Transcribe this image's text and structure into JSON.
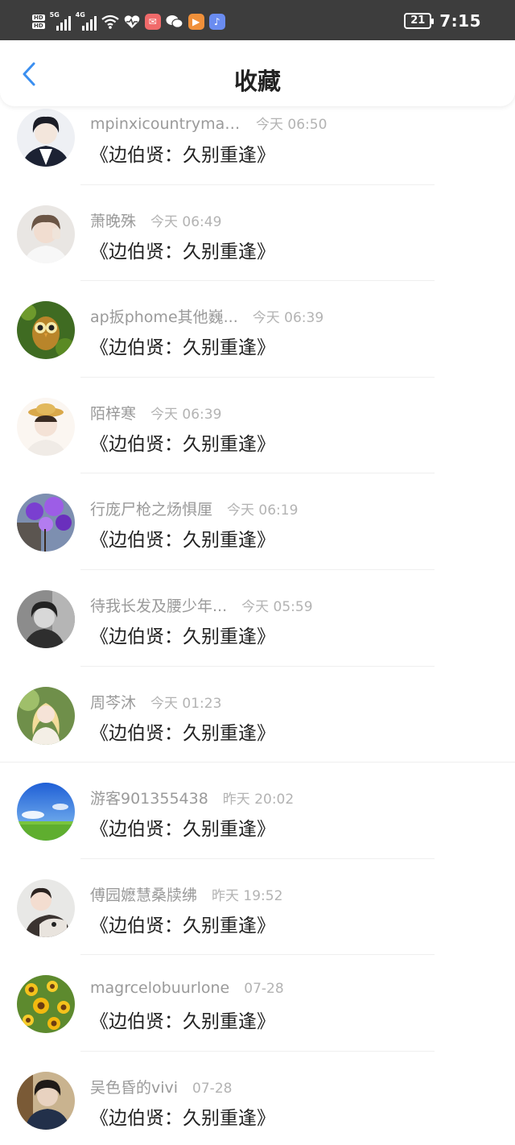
{
  "status_bar": {
    "hd1": "HD",
    "hd2": "HD",
    "net1": "5G",
    "net2": "4G",
    "battery": "21",
    "time": "7:15",
    "icons": [
      "wifi-icon",
      "health-icon",
      "mail-app-icon",
      "wechat-icon",
      "video-app-icon",
      "music-app-icon"
    ]
  },
  "header": {
    "title": "收藏",
    "back_icon": "chevron-left-icon",
    "accent_color": "#3b8ff0"
  },
  "items": [
    {
      "username": "mpinxicountrymak...",
      "time": "今天 06:50",
      "book": "《边伯贤：久别重逢》"
    },
    {
      "username": "萧晚殊",
      "time": "今天 06:49",
      "book": "《边伯贤：久别重逢》"
    },
    {
      "username": "ap扳phome其他巍...",
      "time": "今天 06:39",
      "book": "《边伯贤：久别重逢》"
    },
    {
      "username": "陌梓寒",
      "time": "今天 06:39",
      "book": "《边伯贤：久别重逢》"
    },
    {
      "username": "行庞尸枪之炀惧厘",
      "time": "今天 06:19",
      "book": "《边伯贤：久别重逢》"
    },
    {
      "username": "待我长发及腰少年...",
      "time": "今天 05:59",
      "book": "《边伯贤：久别重逢》"
    },
    {
      "username": "周芩沐",
      "time": "今天 01:23",
      "book": "《边伯贤：久别重逢》"
    },
    {
      "username": "游客901355438",
      "time": "昨天 20:02",
      "book": "《边伯贤：久别重逢》"
    },
    {
      "username": "傅园嬷慧桑牍绋",
      "time": "昨天 19:52",
      "book": "《边伯贤：久别重逢》"
    },
    {
      "username": "magrcelobuurlone",
      "time": "07-28",
      "book": "《边伯贤：久别重逢》"
    },
    {
      "username": "吴色昏的vivi",
      "time": "07-28",
      "book": "《边伯贤：久别重逢》"
    }
  ]
}
